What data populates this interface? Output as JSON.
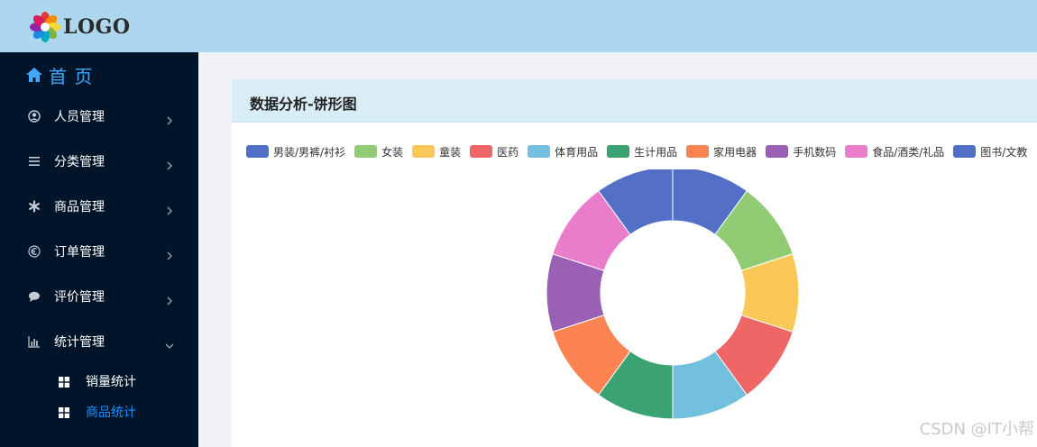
{
  "header": {
    "logo_text": "LOGO"
  },
  "sidebar": {
    "home_label": "首 页",
    "items": [
      {
        "label": "人员管理",
        "icon": "user-circle-icon",
        "expanded": false
      },
      {
        "label": "分类管理",
        "icon": "list-icon",
        "expanded": false
      },
      {
        "label": "商品管理",
        "icon": "asterisk-icon",
        "expanded": false
      },
      {
        "label": "订单管理",
        "icon": "euro-icon",
        "expanded": false
      },
      {
        "label": "评价管理",
        "icon": "comment-icon",
        "expanded": false
      },
      {
        "label": "统计管理",
        "icon": "bar-chart-icon",
        "expanded": true
      }
    ],
    "sub_items": [
      {
        "label": "销量统计",
        "icon": "grid-icon",
        "active": false
      },
      {
        "label": "商品统计",
        "icon": "grid-icon",
        "active": true
      }
    ],
    "colors": {
      "background": "#001529",
      "active": "#1890ff",
      "home": "#40a9ff"
    }
  },
  "panel": {
    "title": "数据分析-饼形图"
  },
  "chart_data": {
    "type": "pie",
    "donut": true,
    "legend_position": "top",
    "categories": [
      "男装/男裤/衬衫",
      "女装",
      "童装",
      "医药",
      "体育用品",
      "生计用品",
      "家用电器",
      "手机数码",
      "食品/酒类/礼品",
      "图书/文教"
    ],
    "values": [
      1,
      1,
      1,
      1,
      1,
      1,
      1,
      1,
      1,
      1
    ],
    "colors": [
      "#5470c6",
      "#91cc75",
      "#fac858",
      "#ee6666",
      "#73c0de",
      "#3ba272",
      "#fc8452",
      "#9a60b4",
      "#ea7ccc",
      "#5470c6"
    ]
  },
  "watermark": "CSDN @IT小帮"
}
